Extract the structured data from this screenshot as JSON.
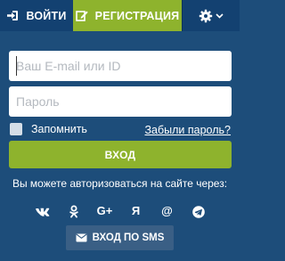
{
  "tabs": {
    "login_label": "ВОЙТИ",
    "register_label": "РЕГИСТРАЦИЯ",
    "settings_icon": "gear-icon"
  },
  "form": {
    "email_placeholder": "Ваш E-mail или ID",
    "email_value": "",
    "password_placeholder": "Пароль",
    "password_value": "",
    "remember_label": "Запомнить",
    "remember_checked": false,
    "forgot_label": "Забыли пароль?",
    "submit_label": "ВХОД"
  },
  "social": {
    "prompt": "Вы можете авторизоваться на сайте через:",
    "providers": [
      "vk-icon",
      "odnoklassniki-icon",
      "google-plus-icon",
      "yandex-icon",
      "mailru-icon",
      "telegram-icon"
    ],
    "google_label": "G+",
    "yandex_label": "Я",
    "mail_label": "@",
    "sms_label": "ВХОД ПО SMS"
  },
  "colors": {
    "panel": "#1d4d7a",
    "tab_bar": "#134171",
    "accent_green": "#8eb32d",
    "sms_button": "#3a5f85"
  }
}
